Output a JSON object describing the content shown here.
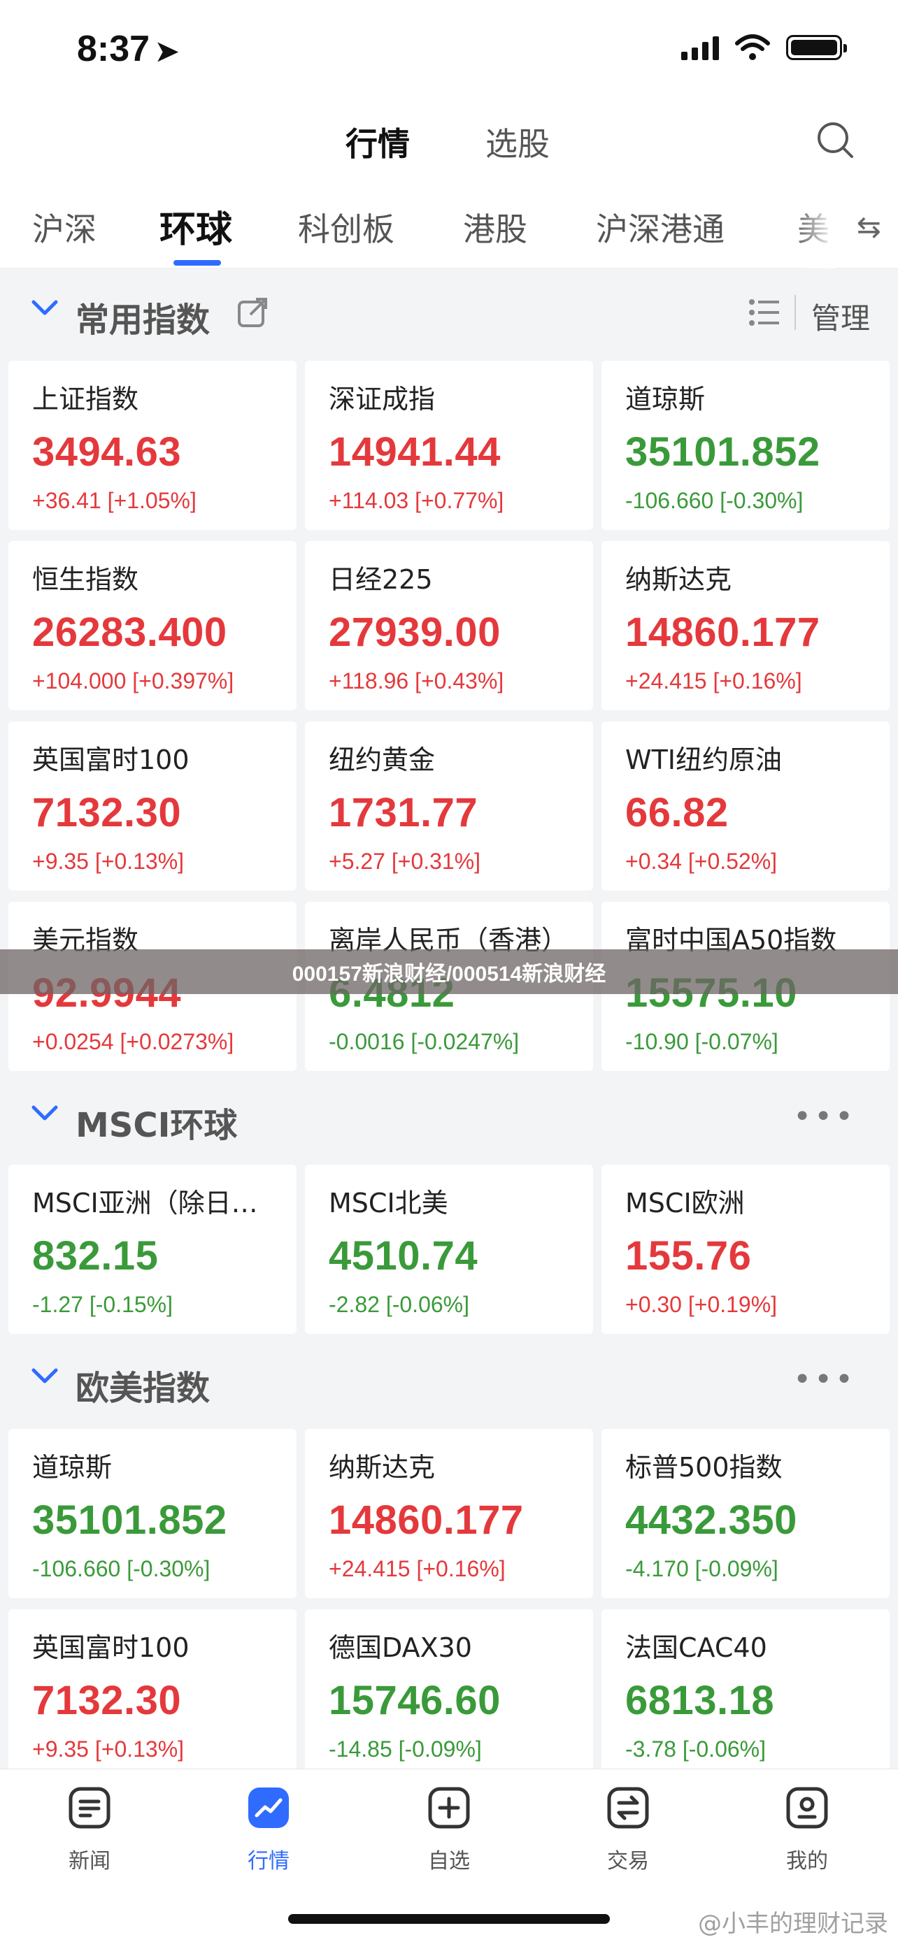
{
  "status_bar": {
    "time": "8:37"
  },
  "top_tabs": {
    "active": "行情",
    "inactive": "选股"
  },
  "sub_tabs": [
    "沪深",
    "环球",
    "科创板",
    "港股",
    "沪深港通",
    "美"
  ],
  "sections": {
    "common": {
      "title": "常用指数",
      "manage": "管理",
      "cards": [
        {
          "name": "上证指数",
          "price": "3494.63",
          "change": "+36.41 [+1.05%]",
          "dir": "up"
        },
        {
          "name": "深证成指",
          "price": "14941.44",
          "change": "+114.03 [+0.77%]",
          "dir": "up"
        },
        {
          "name": "道琼斯",
          "price": "35101.852",
          "change": "-106.660 [-0.30%]",
          "dir": "down"
        },
        {
          "name": "恒生指数",
          "price": "26283.400",
          "change": "+104.000 [+0.397%]",
          "dir": "up"
        },
        {
          "name": "日经225",
          "price": "27939.00",
          "change": "+118.96 [+0.43%]",
          "dir": "up"
        },
        {
          "name": "纳斯达克",
          "price": "14860.177",
          "change": "+24.415 [+0.16%]",
          "dir": "up"
        },
        {
          "name": "英国富时100",
          "price": "7132.30",
          "change": "+9.35 [+0.13%]",
          "dir": "up"
        },
        {
          "name": "纽约黄金",
          "price": "1731.77",
          "change": "+5.27 [+0.31%]",
          "dir": "up"
        },
        {
          "name": "WTI纽约原油",
          "price": "66.82",
          "change": "+0.34 [+0.52%]",
          "dir": "up"
        },
        {
          "name": "美元指数",
          "price": "92.9944",
          "change": "+0.0254 [+0.0273%]",
          "dir": "up"
        },
        {
          "name": "离岸人民币（香港）",
          "price": "6.4812",
          "change": "-0.0016 [-0.0247%]",
          "dir": "down"
        },
        {
          "name": "富时中国A50指数",
          "price": "15575.10",
          "change": "-10.90 [-0.07%]",
          "dir": "down"
        }
      ]
    },
    "msci": {
      "title": "MSCI环球",
      "cards": [
        {
          "name": "MSCI亚洲（除日…",
          "price": "832.15",
          "change": "-1.27 [-0.15%]",
          "dir": "down"
        },
        {
          "name": "MSCI北美",
          "price": "4510.74",
          "change": "-2.82 [-0.06%]",
          "dir": "down"
        },
        {
          "name": "MSCI欧洲",
          "price": "155.76",
          "change": "+0.30 [+0.19%]",
          "dir": "up"
        }
      ]
    },
    "euro_us": {
      "title": "欧美指数",
      "cards": [
        {
          "name": "道琼斯",
          "price": "35101.852",
          "change": "-106.660 [-0.30%]",
          "dir": "down"
        },
        {
          "name": "纳斯达克",
          "price": "14860.177",
          "change": "+24.415 [+0.16%]",
          "dir": "up"
        },
        {
          "name": "标普500指数",
          "price": "4432.350",
          "change": "-4.170 [-0.09%]",
          "dir": "down"
        },
        {
          "name": "英国富时100",
          "price": "7132.30",
          "change": "+9.35 [+0.13%]",
          "dir": "up"
        },
        {
          "name": "德国DAX30",
          "price": "15746.60",
          "change": "-14.85 [-0.09%]",
          "dir": "down"
        },
        {
          "name": "法国CAC40",
          "price": "6813.18",
          "change": "-3.78 [-0.06%]",
          "dir": "down"
        }
      ]
    }
  },
  "overlay_text": "000157新浪财经/000514新浪财经",
  "bottom_nav": [
    {
      "label": "新闻",
      "icon": "news-icon"
    },
    {
      "label": "行情",
      "icon": "market-icon",
      "active": true
    },
    {
      "label": "自选",
      "icon": "watchlist-icon"
    },
    {
      "label": "交易",
      "icon": "trade-icon"
    },
    {
      "label": "我的",
      "icon": "profile-icon"
    }
  ],
  "watermark": "@小丰的理财记录",
  "colors": {
    "up": "#e4393c",
    "down": "#3a9a3a",
    "accent": "#2f6bff"
  }
}
